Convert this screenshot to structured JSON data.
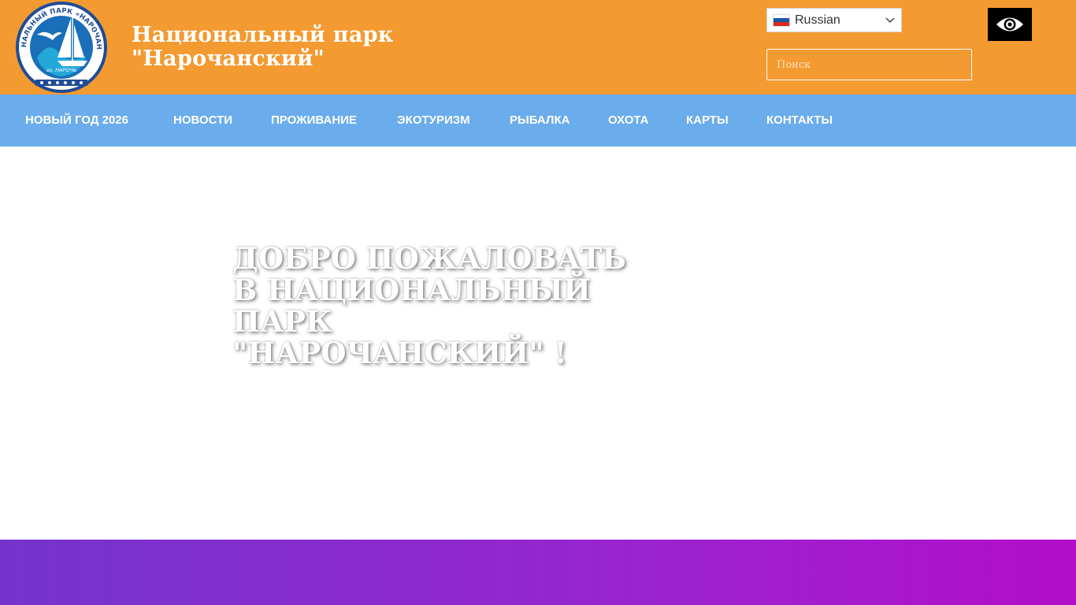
{
  "colors": {
    "header_bg": "#f39a30",
    "nav_bg": "#6aacec",
    "footer_gradient_start": "#7434cc",
    "footer_gradient_end": "#b20ec9"
  },
  "header": {
    "logo": {
      "icon": "park-emblem-icon",
      "inscription_top": "НАЦИОНАЛЬНЫЙ ПАРК «НАРОЧАНСКИЙ»",
      "inscription_lake": "оз. НАРОЧЬ"
    },
    "title": "Национальный парк \"Нарочанский\"",
    "language": {
      "label": "Russian",
      "icon": "russia-flag-icon"
    },
    "search": {
      "placeholder": "Поиск",
      "value": ""
    },
    "accessibility": {
      "icon": "eye-icon"
    }
  },
  "nav": {
    "items": [
      {
        "label": "НОВЫЙ ГОД 2026"
      },
      {
        "label": "НОВОСТИ"
      },
      {
        "label": "ПРОЖИВАНИЕ"
      },
      {
        "label": "ЭКОТУРИЗМ"
      },
      {
        "label": "РЫБАЛКА"
      },
      {
        "label": "ОХОТА"
      },
      {
        "label": "КАРТЫ"
      },
      {
        "label": "КОНТАКТЫ"
      }
    ]
  },
  "hero": {
    "heading": "ДОБРО ПОЖАЛОВАТЬ В НАЦИОНАЛЬНЫЙ ПАРК \"НАРОЧАНСКИЙ\" !"
  }
}
